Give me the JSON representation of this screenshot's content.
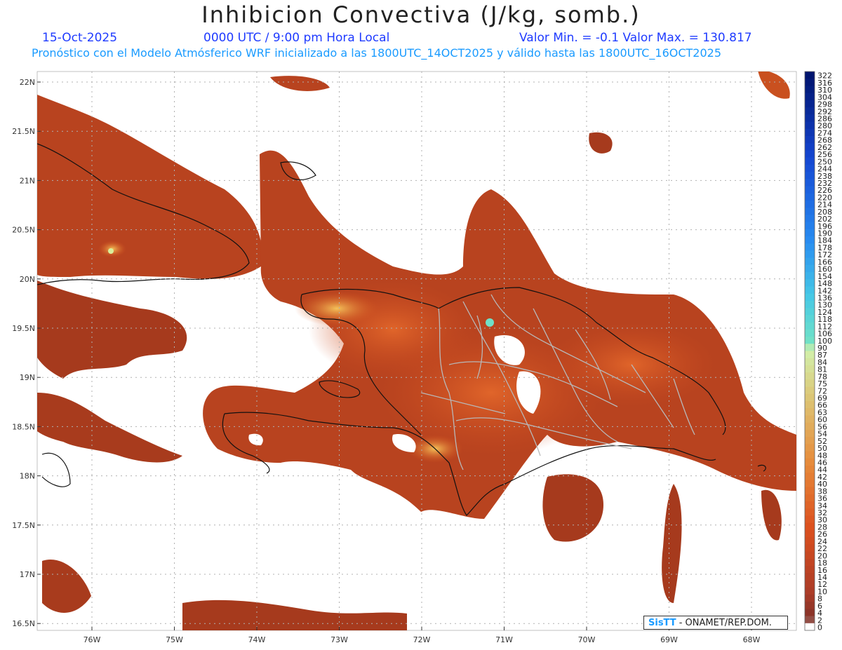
{
  "header": {
    "title": "Inhibicion Convectiva (J/kg, somb.)",
    "date": "15-Oct-2025",
    "time": "0000 UTC / 9:00 pm Hora Local",
    "stats": "Valor Min. = -0.1  Valor Max. = 130.817",
    "model_line": "Pronóstico con el Modelo Atmósferico WRF inicializado a las 1800UTC_14OCT2025 y válido hasta las  1800UTC_16OCT2025"
  },
  "lat_labels": [
    "22N",
    "21.5N",
    "21N",
    "20.5N",
    "20N",
    "19.5N",
    "19N",
    "18.5N",
    "18N",
    "17.5N",
    "17N",
    "16.5N"
  ],
  "lon_labels": [
    "76W",
    "75W",
    "74W",
    "73W",
    "72W",
    "71W",
    "70W",
    "69W",
    "68W"
  ],
  "colorbar": {
    "labels": [
      "322",
      "316",
      "310",
      "304",
      "298",
      "292",
      "286",
      "280",
      "274",
      "268",
      "262",
      "256",
      "250",
      "244",
      "238",
      "232",
      "226",
      "220",
      "214",
      "208",
      "202",
      "196",
      "190",
      "184",
      "178",
      "172",
      "166",
      "160",
      "154",
      "148",
      "142",
      "136",
      "130",
      "124",
      "118",
      "112",
      "106",
      "100",
      "90",
      "87",
      "84",
      "81",
      "78",
      "75",
      "72",
      "69",
      "66",
      "63",
      "60",
      "56",
      "54",
      "52",
      "50",
      "48",
      "46",
      "44",
      "42",
      "40",
      "38",
      "36",
      "34",
      "32",
      "30",
      "28",
      "26",
      "24",
      "22",
      "20",
      "18",
      "16",
      "14",
      "12",
      "10",
      "8",
      "6",
      "4",
      "2",
      "0"
    ]
  },
  "credit": {
    "logo": "SisTT",
    "org": "- ONAMET/REP.DOM."
  }
}
